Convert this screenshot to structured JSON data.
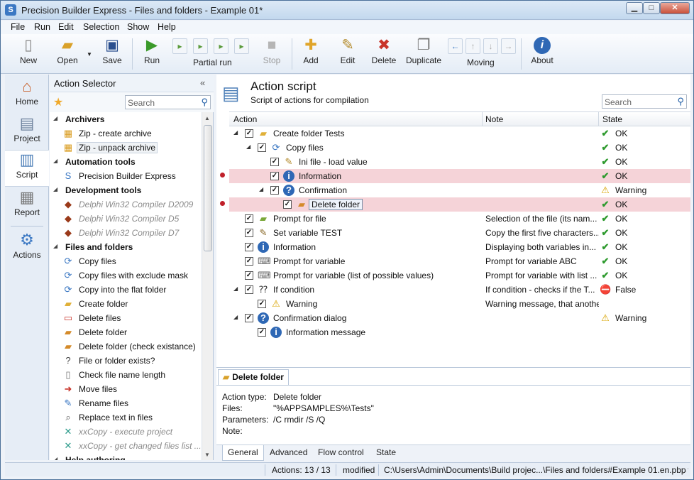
{
  "window": {
    "title": "Precision Builder Express - Files and folders - Example 01*",
    "app_icon": "S",
    "controls": {
      "minimize": "▁",
      "maximize": "□",
      "close": "✕"
    }
  },
  "menu": [
    "File",
    "Run",
    "Edit",
    "Selection",
    "Show",
    "Help"
  ],
  "toolbar": {
    "new": "New",
    "open": "Open",
    "save": "Save",
    "run": "Run",
    "partial_run": "Partial run",
    "stop": "Stop",
    "add": "Add",
    "edit": "Edit",
    "delete": "Delete",
    "duplicate": "Duplicate",
    "moving": "Moving",
    "about": "About"
  },
  "nav": [
    {
      "label": "Home",
      "icon": "home-icon"
    },
    {
      "label": "Project",
      "icon": "project-icon"
    },
    {
      "label": "Script",
      "icon": "script-icon"
    },
    {
      "label": "Report",
      "icon": "report-icon"
    },
    {
      "label": "Actions",
      "icon": "actions-icon"
    }
  ],
  "selector": {
    "title": "Action Selector",
    "collapse": "«",
    "search_placeholder": "Search",
    "items": [
      {
        "type": "group",
        "label": "Archivers"
      },
      {
        "type": "item",
        "label": "Zip - create archive",
        "icon": "zip-icon"
      },
      {
        "type": "item",
        "label": "Zip - unpack archive",
        "icon": "zip-icon",
        "selected": true
      },
      {
        "type": "group",
        "label": "Automation tools"
      },
      {
        "type": "item",
        "label": "Precision Builder Express",
        "icon": "app-icon"
      },
      {
        "type": "group",
        "label": "Development tools"
      },
      {
        "type": "item",
        "label": "Delphi Win32 Compiler D2009",
        "icon": "delphi-icon",
        "disabled": true
      },
      {
        "type": "item",
        "label": "Delphi Win32 Compiler D5",
        "icon": "delphi-icon",
        "disabled": true
      },
      {
        "type": "item",
        "label": "Delphi Win32 Compiler D7",
        "icon": "delphi-icon",
        "disabled": true
      },
      {
        "type": "group",
        "label": "Files and folders"
      },
      {
        "type": "item",
        "label": "Copy files",
        "icon": "copy-icon"
      },
      {
        "type": "item",
        "label": "Copy files with exclude mask",
        "icon": "copy-icon"
      },
      {
        "type": "item",
        "label": "Copy into the flat folder",
        "icon": "copy-icon"
      },
      {
        "type": "item",
        "label": "Create folder",
        "icon": "folder-icon"
      },
      {
        "type": "item",
        "label": "Delete files",
        "icon": "delete-file-icon"
      },
      {
        "type": "item",
        "label": "Delete folder",
        "icon": "delete-folder-icon"
      },
      {
        "type": "item",
        "label": "Delete folder (check existance)",
        "icon": "delete-folder-icon"
      },
      {
        "type": "item",
        "label": "File or folder exists?",
        "icon": "question-icon"
      },
      {
        "type": "item",
        "label": "Check file name length",
        "icon": "file-icon"
      },
      {
        "type": "item",
        "label": "Move files",
        "icon": "move-icon"
      },
      {
        "type": "item",
        "label": "Rename files",
        "icon": "rename-icon"
      },
      {
        "type": "item",
        "label": "Replace text in files",
        "icon": "replace-icon"
      },
      {
        "type": "item",
        "label": "xxCopy - execute project",
        "icon": "xxcopy-icon",
        "disabled": true
      },
      {
        "type": "item",
        "label": "xxCopy - get changed files list ...",
        "icon": "xxcopy-icon",
        "disabled": true
      },
      {
        "type": "group",
        "label": "Help authoring"
      }
    ]
  },
  "script": {
    "title": "Action script",
    "subtitle": "Script of actions for compilation",
    "search_placeholder": "Search",
    "columns": {
      "action": "Action",
      "note": "Note",
      "state": "State"
    },
    "rows": [
      {
        "level": 0,
        "expand": "◢",
        "label": "Create folder Tests",
        "icon": "folder-icon",
        "note": "",
        "state": "OK"
      },
      {
        "level": 1,
        "expand": "◢",
        "label": "Copy files",
        "icon": "copy-icon",
        "note": "",
        "state": "OK"
      },
      {
        "level": 2,
        "expand": "",
        "label": "Ini file - load value",
        "icon": "ini-icon",
        "note": "",
        "state": "OK"
      },
      {
        "level": 2,
        "expand": "",
        "label": "Information",
        "icon": "info-icon",
        "note": "",
        "state": "OK",
        "highlight": true,
        "breakpoint": true
      },
      {
        "level": 2,
        "expand": "◢",
        "label": "Confirmation",
        "icon": "question-icon",
        "note": "",
        "state": "Warning"
      },
      {
        "level": 3,
        "expand": "",
        "label": "Delete folder",
        "icon": "delete-folder-icon",
        "note": "",
        "state": "OK",
        "highlight": true,
        "breakpoint": true,
        "focused": true
      },
      {
        "level": 0,
        "expand": "",
        "label": "Prompt for file",
        "icon": "prompt-file-icon",
        "note": "Selection of the file (its nam...",
        "state": "OK"
      },
      {
        "level": 0,
        "expand": "",
        "label": "Set variable TEST",
        "icon": "variable-icon",
        "note": "Copy the first five characters...",
        "state": "OK"
      },
      {
        "level": 0,
        "expand": "",
        "label": "Information",
        "icon": "info-icon",
        "note": "Displaying both variables in...",
        "state": "OK"
      },
      {
        "level": 0,
        "expand": "",
        "label": "Prompt for variable",
        "icon": "keyboard-icon",
        "note": "Prompt for variable ABC",
        "state": "OK"
      },
      {
        "level": 0,
        "expand": "",
        "label": "Prompt for variable (list of possible values)",
        "icon": "keyboard-icon",
        "note": "Prompt for variable with list ...",
        "state": "OK"
      },
      {
        "level": 0,
        "expand": "◢",
        "label": "If condition",
        "icon": "condition-icon",
        "note": "If condition - checks if the T...",
        "state": "False"
      },
      {
        "level": 1,
        "expand": "",
        "label": "Warning",
        "icon": "warning-icon",
        "note": "Warning message, that another value has been selec...",
        "state": ""
      },
      {
        "level": 0,
        "expand": "◢",
        "label": "Confirmation dialog",
        "icon": "question-icon",
        "note": "",
        "state": "Warning"
      },
      {
        "level": 1,
        "expand": "",
        "label": "Information message",
        "icon": "info-icon",
        "note": "",
        "state": ""
      }
    ]
  },
  "details": {
    "tab_label": "Delete folder",
    "fields": [
      {
        "key": "Action type:",
        "value": "Delete folder"
      },
      {
        "key": "Files:",
        "value": "\"%APPSAMPLES%\\Tests\""
      },
      {
        "key": "Parameters:",
        "value": "/C rmdir /S /Q"
      },
      {
        "key": "Note:",
        "value": ""
      }
    ],
    "tabs": [
      "General",
      "Advanced",
      "Flow control",
      "State"
    ]
  },
  "status": {
    "actions": "Actions: 13 / 13",
    "modified": "modified",
    "path": "C:\\Users\\Admin\\Documents\\Build projec...\\Files and folders#Example 01.en.pbp"
  },
  "colors": {
    "accent": "#3b78c3",
    "highlight_row": "#f5d3d8",
    "ok": "#2e9a2e",
    "warning": "#d9a400",
    "false": "#c21717"
  }
}
